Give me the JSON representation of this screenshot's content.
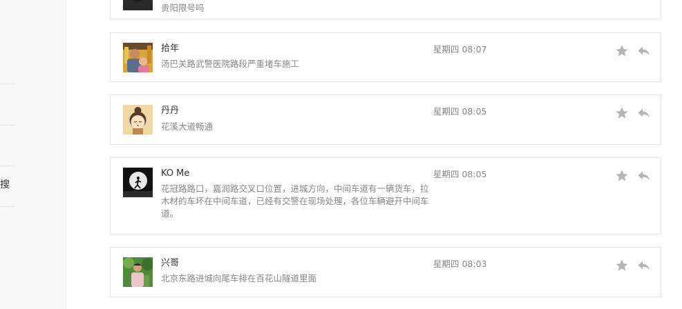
{
  "sidebar": {
    "visible_fragment": "搜"
  },
  "messages": [
    {
      "name": "",
      "text": "贵阳限号吗",
      "time": "",
      "avatar": "dark-avatar"
    },
    {
      "name": "拾年",
      "text": "汤巴关路武警医院路段严重堵车施工",
      "time": "星期四 08:07",
      "avatar": "family-photo-avatar"
    },
    {
      "name": "丹丹",
      "text": "花溪大道畅通",
      "time": "星期四 08:05",
      "avatar": "cartoon-girl-avatar"
    },
    {
      "name": "KO Me",
      "text": "花冠路路口，嘉润路交叉口位置，进城方向，中间车道有一辆货车，拉木材的车坏在中间车道，已经有交警在现场处理，各位车辆避开中间车道。",
      "time": "星期四 08:05",
      "avatar": "moon-runner-avatar"
    },
    {
      "name": "兴哥",
      "text": "北京东路进城向尾车排在百花山隧道里面",
      "time": "星期四 08:03",
      "avatar": "outdoor-man-avatar"
    }
  ],
  "colors": {
    "card_border": "#e3e3e3",
    "muted_text": "#888888",
    "icon_gray": "#b5b5b5",
    "sidebar_bg": "#f8f8f8"
  }
}
